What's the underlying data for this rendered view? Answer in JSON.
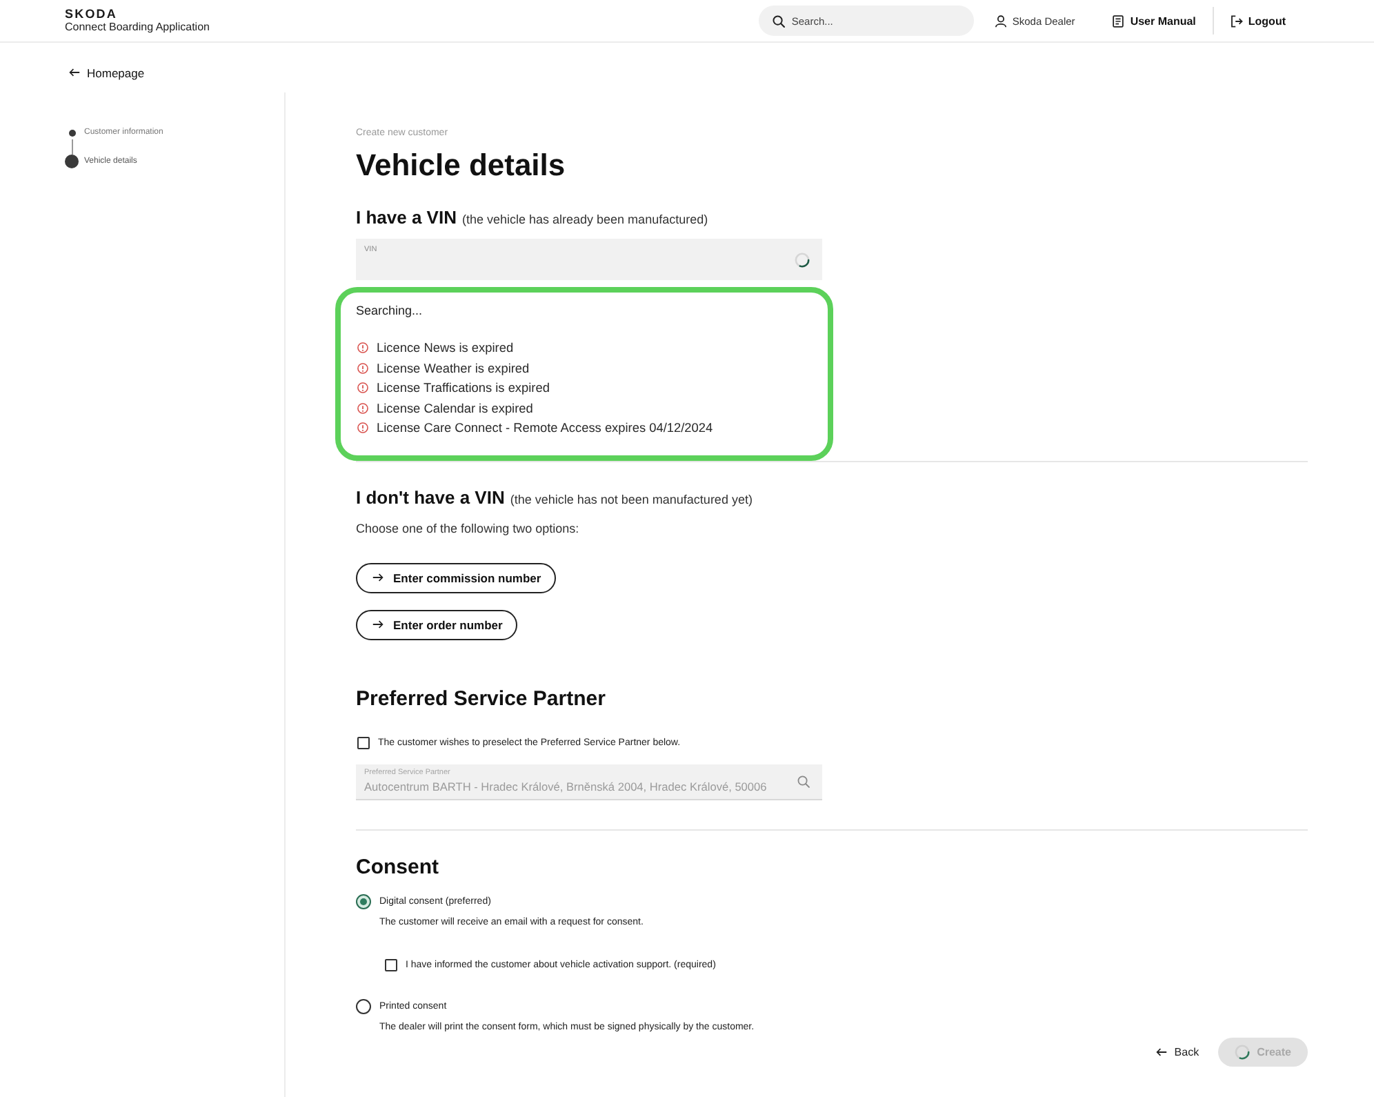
{
  "header": {
    "brand": "SKODA",
    "app_name": "Connect Boarding Application",
    "search": {
      "placeholder": "Search..."
    },
    "user": "Skoda Dealer",
    "links": [
      {
        "kind": "manual",
        "label": "User Manual"
      },
      {
        "kind": "logout",
        "label": "Logout"
      }
    ]
  },
  "back_link": "Homepage",
  "steps": [
    {
      "label": "Customer information",
      "selected": false
    },
    {
      "label": "Vehicle details",
      "selected": true
    }
  ],
  "breadcrumb": "Create new customer",
  "title": "Vehicle details",
  "vin": {
    "heading": "I have a VIN",
    "note": "(the vehicle has already been manufactured)",
    "field": {
      "label": "VIN",
      "loading": true
    },
    "result": {
      "highlighted": true,
      "status": "Searching...",
      "messages": [
        "Licence News is expired",
        "License Weather is expired",
        "License Traffications is expired",
        "License Calendar is expired",
        "License Care Connect - Remote Access expires 04/12/2024"
      ]
    }
  },
  "no_vin": {
    "heading": "I don't have a VIN",
    "note": "(the vehicle has not been manufactured yet)",
    "hint": "Choose one of the following two options:",
    "buttons": [
      "Enter commission number",
      "Enter order number"
    ]
  },
  "service_partner": {
    "heading": "Preferred Service Partner",
    "checkbox": {
      "label": "The customer wishes to preselect the Preferred Service Partner below.",
      "checked": false
    },
    "field": {
      "label": "Preferred Service Partner",
      "value": "Autocentrum BARTH - Hradec Králové, Brněnská 2004, Hradec Králové, 50006",
      "disabled": true
    }
  },
  "consent": {
    "heading": "Consent",
    "options": [
      {
        "label": "Digital consent (preferred)",
        "description": "The customer will receive an email with a request for consent.",
        "selected": true,
        "checkbox": {
          "label": "I have informed the customer about vehicle activation support. (required)",
          "checked": false
        }
      },
      {
        "label": "Printed consent",
        "description": "The dealer will print the consent form, which must be signed physically by the customer.",
        "selected": false
      }
    ]
  },
  "actions": {
    "back": "Back",
    "create": {
      "label": "Create",
      "disabled": true,
      "loading": true
    }
  }
}
